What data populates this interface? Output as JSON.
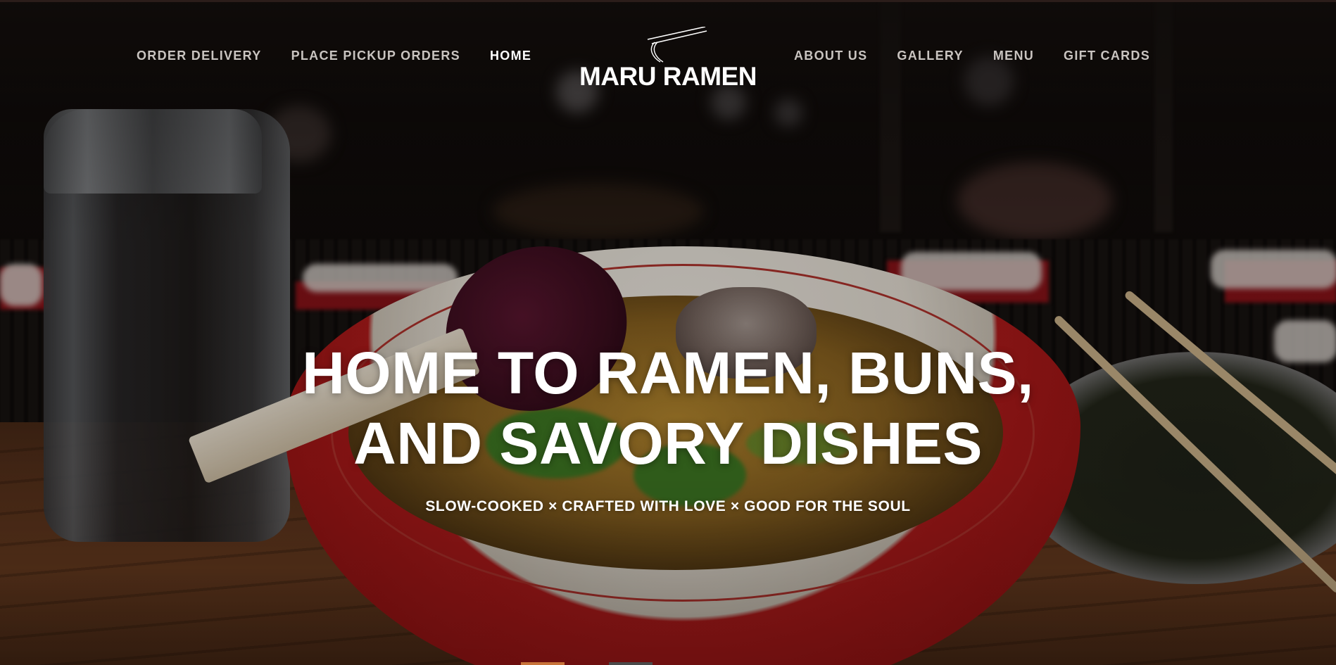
{
  "header": {
    "logo": {
      "text": "MARU RAMEN",
      "icon": "chopsticks-icon"
    },
    "nav_left": [
      {
        "label": "ORDER DELIVERY",
        "active": false
      },
      {
        "label": "PLACE PICKUP ORDERS",
        "active": false
      },
      {
        "label": "HOME",
        "active": true
      }
    ],
    "nav_right": [
      {
        "label": "ABOUT US",
        "active": false
      },
      {
        "label": "GALLERY",
        "active": false
      },
      {
        "label": "MENU",
        "active": false
      },
      {
        "label": "GIFT CARDS",
        "active": false
      }
    ]
  },
  "hero": {
    "title_line1": "HOME TO RAMEN, BUNS,",
    "title_line2": "AND SAVORY DISHES",
    "subtitle": "SLOW-COOKED × CRAFTED WITH LOVE × GOOD FOR THE SOUL",
    "background": "ramen-bowl-photo"
  },
  "slider": {
    "slides": 2,
    "active_index": 0
  },
  "colors": {
    "nav_text": "#c9c4c0",
    "nav_active": "#ffffff",
    "slide_active": "#c8733a",
    "slide_inactive": "#4a4a4a"
  }
}
